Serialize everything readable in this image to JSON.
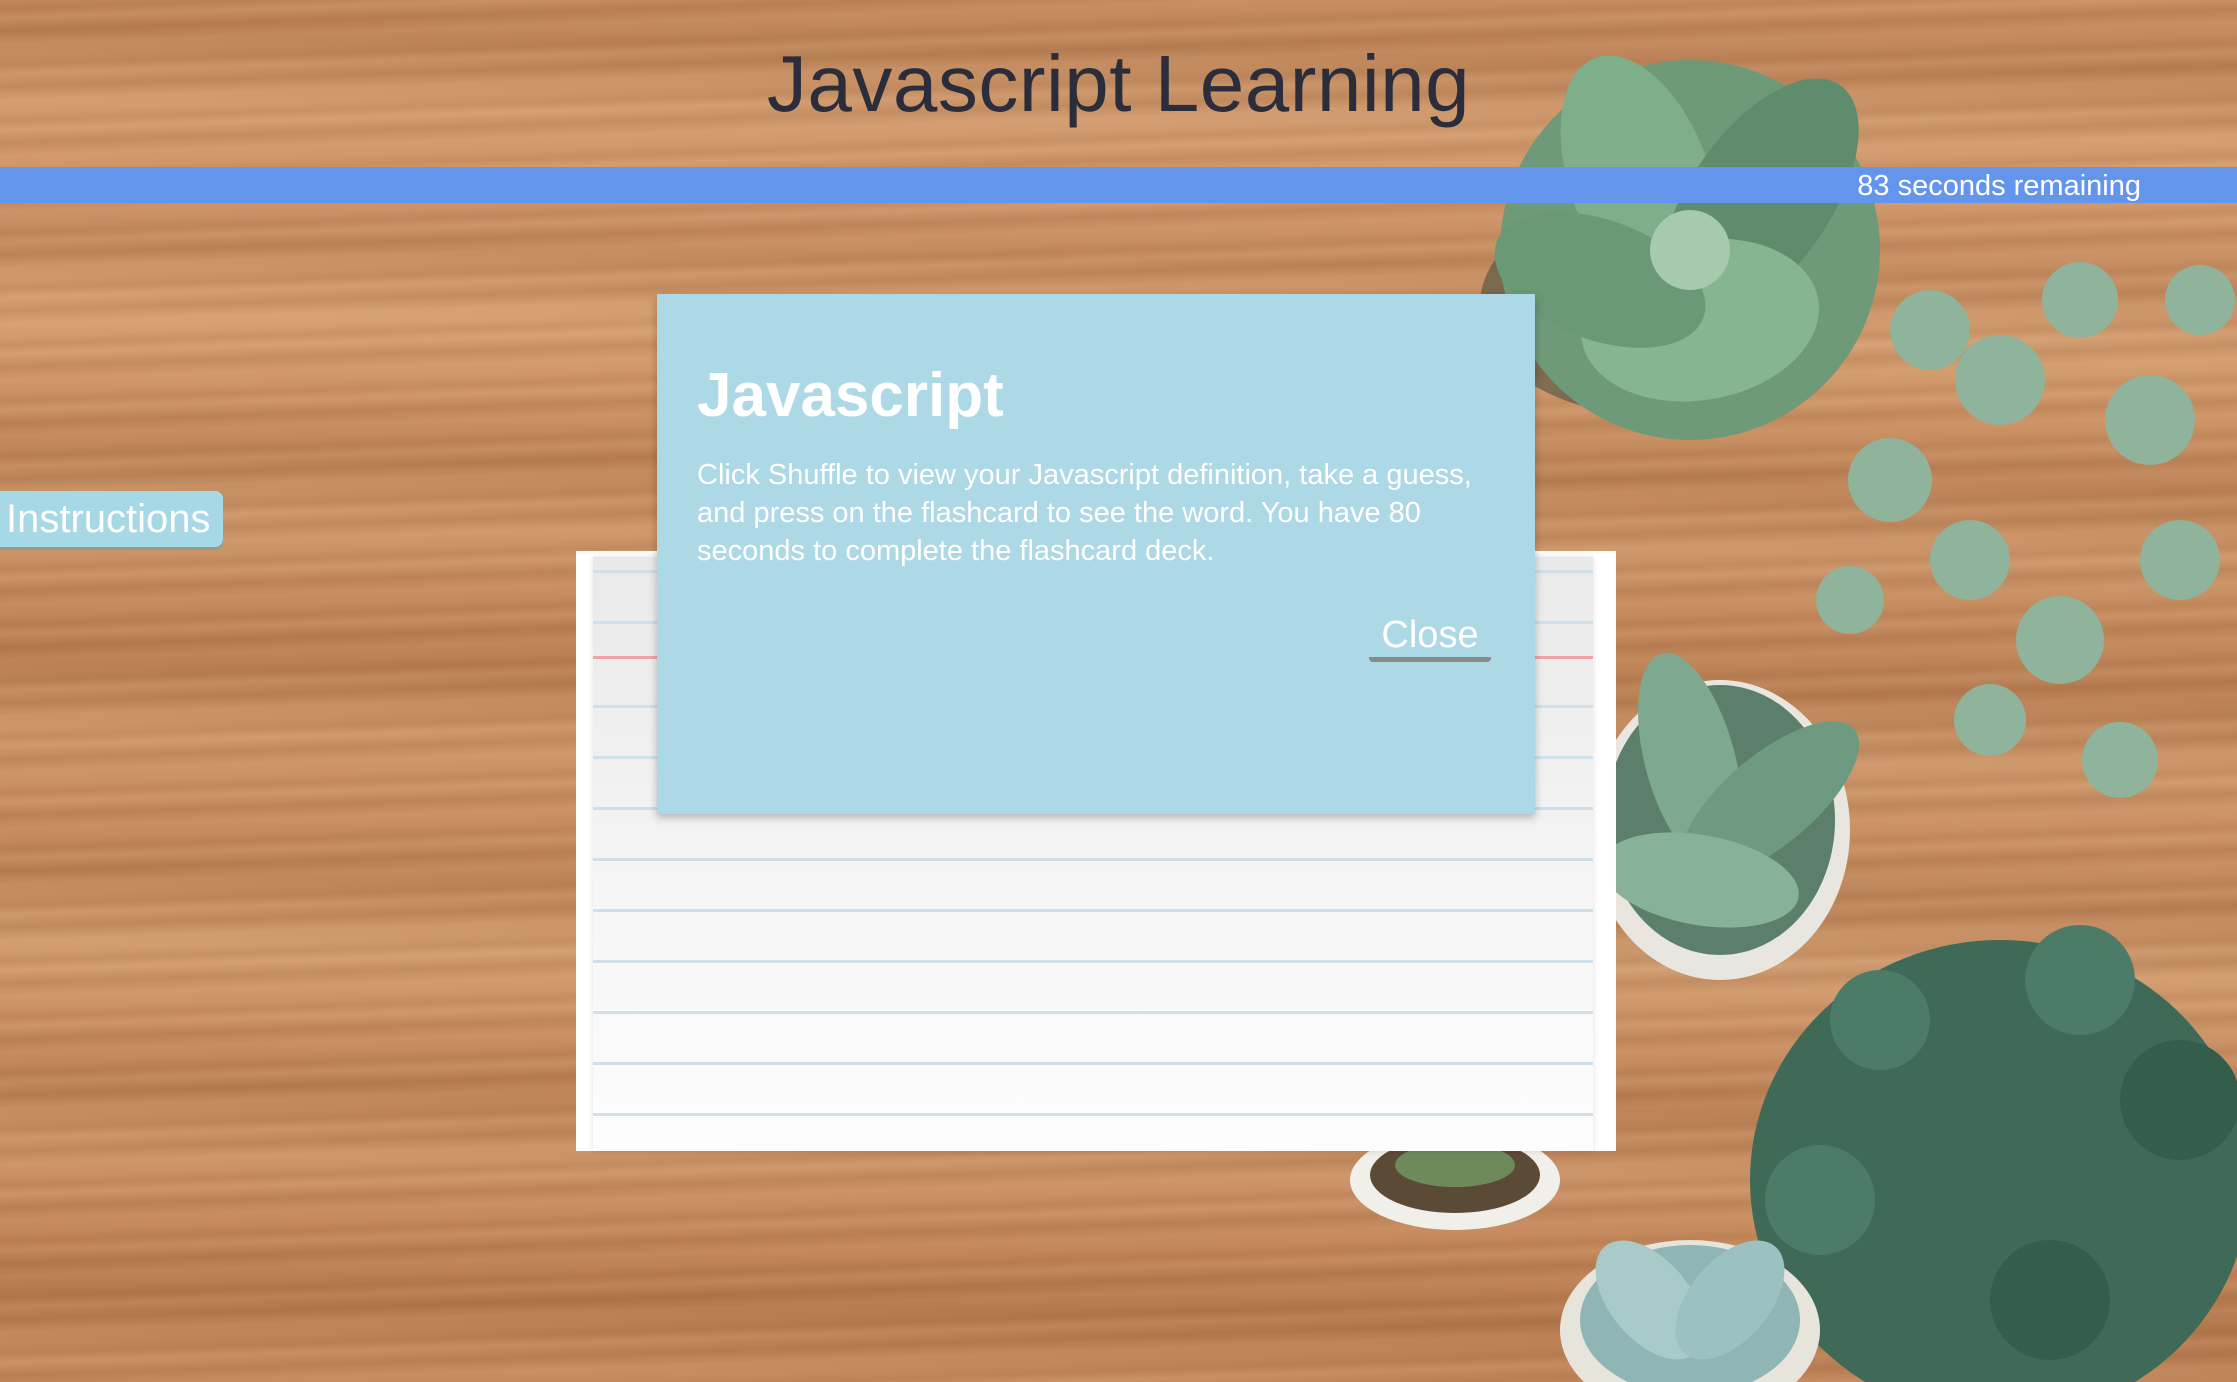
{
  "header": {
    "title": "Javascript Learning"
  },
  "timer": {
    "text": "83 seconds remaining"
  },
  "sidebar": {
    "instructions_label": "Instructions"
  },
  "modal": {
    "title": "Javascript",
    "body": "Click Shuffle to view your Javascript definition, take a guess, and press on the flashcard to see the word. You have 80 seconds to complete the flashcard deck.",
    "close_label": "Close"
  },
  "colors": {
    "timer_bar": "#6495ed",
    "modal_background": "#add8e6",
    "instructions_button": "#a6d8e6",
    "title_text": "#2b2e3a"
  },
  "decor": {
    "background": "wooden-desk-with-succulents-photo"
  }
}
